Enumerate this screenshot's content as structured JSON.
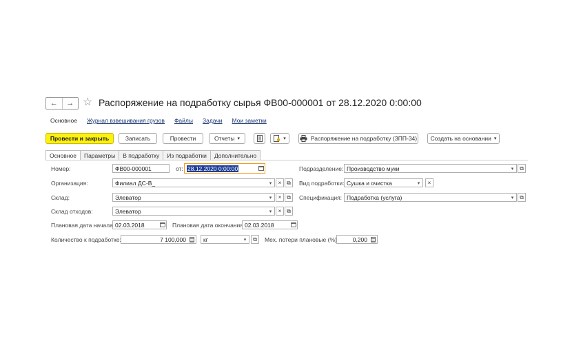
{
  "header": {
    "back_icon": "←",
    "forward_icon": "→",
    "star_icon": "☆",
    "title": "Распоряжение на подработку сырья ФВ00-000001 от 28.12.2020 0:00:00"
  },
  "navlinks": [
    "Основное",
    "Журнал взвешивания грузов",
    "Файлы",
    "Задачи",
    "Мои заметки"
  ],
  "toolbar": {
    "post_close": "Провести и закрыть",
    "write": "Записать",
    "post": "Провести",
    "reports": "Отчеты",
    "print_order": "Распоряжение на подработку (ЗПП-34)",
    "create_based": "Создать на основании"
  },
  "tabs": [
    "Основное",
    "Параметры",
    "В подработку",
    "Из подработки",
    "Дополнительно"
  ],
  "form": {
    "number_label": "Номер:",
    "number_value": "ФВ00-000001",
    "date_label": "от:",
    "date_value": "28.12.2020  0:00:00",
    "division_label": "Подразделение:",
    "division_value": "Производство муки",
    "org_label": "Организация:",
    "org_value": "Филиал ДС-В_",
    "kind_label": "Вид подработки:",
    "kind_value": "Сушка и очистка",
    "warehouse_label": "Склад:",
    "warehouse_value": "Элеватор",
    "spec_label": "Спецификация:",
    "spec_value": "Подработка (услуга)",
    "waste_label": "Склад отходов:",
    "waste_value": "Элеватор",
    "plan_start_label": "Плановая дата начала:",
    "plan_start_value": "02.03.2018",
    "plan_end_label": "Плановая дата окончания:",
    "plan_end_value": "02.03.2018",
    "qty_label": "Количество к подработке:",
    "qty_value": "7 100,000",
    "unit_value": "кг",
    "loss_label": "Мех. потери плановые (%):",
    "loss_value": "0,200"
  }
}
